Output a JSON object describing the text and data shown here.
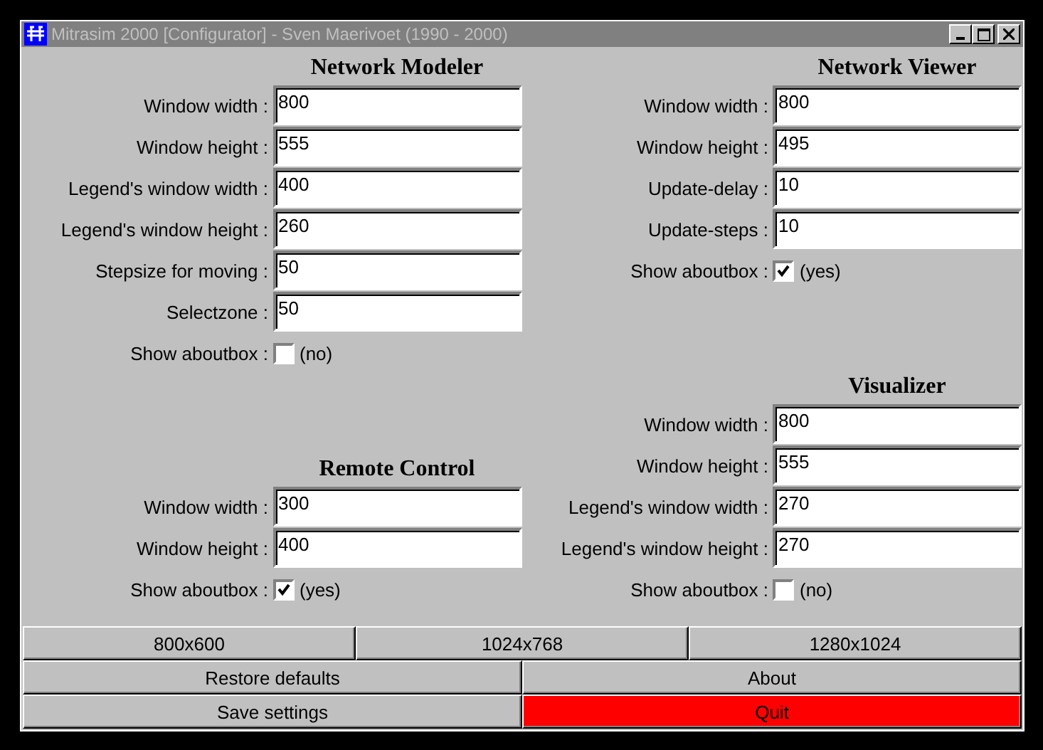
{
  "window": {
    "title": "Mitrasim 2000 [Configurator] - Sven Maerivoet (1990 - 2000)"
  },
  "columns": [
    [
      {
        "title": "Network Modeler",
        "rows": [
          {
            "kind": "field",
            "label": "Window width :",
            "value": "800"
          },
          {
            "kind": "field",
            "label": "Window height :",
            "value": "555"
          },
          {
            "kind": "field",
            "label": "Legend's window width :",
            "value": "400"
          },
          {
            "kind": "field",
            "label": "Legend's window height :",
            "value": "260"
          },
          {
            "kind": "field",
            "label": "Stepsize for moving :",
            "value": "50"
          },
          {
            "kind": "field",
            "label": "Selectzone :",
            "value": "50"
          },
          {
            "kind": "checkbox",
            "label": "Show aboutbox :",
            "checked": false,
            "text": "(no)"
          }
        ]
      },
      {
        "title": "Remote Control",
        "rows": [
          {
            "kind": "field",
            "label": "Window width :",
            "value": "300"
          },
          {
            "kind": "field",
            "label": "Window height :",
            "value": "400"
          },
          {
            "kind": "checkbox",
            "label": "Show aboutbox :",
            "checked": true,
            "text": "(yes)"
          }
        ]
      }
    ],
    [
      {
        "title": "Network Viewer",
        "rows": [
          {
            "kind": "field",
            "label": "Window width :",
            "value": "800"
          },
          {
            "kind": "field",
            "label": "Window height :",
            "value": "495"
          },
          {
            "kind": "field",
            "label": "Update-delay :",
            "value": "10"
          },
          {
            "kind": "field",
            "label": "Update-steps :",
            "value": "10"
          },
          {
            "kind": "checkbox",
            "label": "Show aboutbox :",
            "checked": true,
            "text": "(yes)"
          }
        ]
      },
      {
        "title": "Visualizer",
        "rows": [
          {
            "kind": "field",
            "label": "Window width :",
            "value": "800"
          },
          {
            "kind": "field",
            "label": "Window height :",
            "value": "555"
          },
          {
            "kind": "field",
            "label": "Legend's window width :",
            "value": "270"
          },
          {
            "kind": "field",
            "label": "Legend's window height :",
            "value": "270"
          },
          {
            "kind": "checkbox",
            "label": "Show aboutbox :",
            "checked": false,
            "text": "(no)"
          }
        ]
      }
    ]
  ],
  "resolution_buttons": [
    "800x600",
    "1024x768",
    "1280x1024"
  ],
  "action_buttons": [
    {
      "label": "Restore defaults",
      "kind": "normal"
    },
    {
      "label": "About",
      "kind": "normal"
    },
    {
      "label": "Save settings",
      "kind": "normal"
    },
    {
      "label": "Quit",
      "kind": "danger"
    }
  ]
}
